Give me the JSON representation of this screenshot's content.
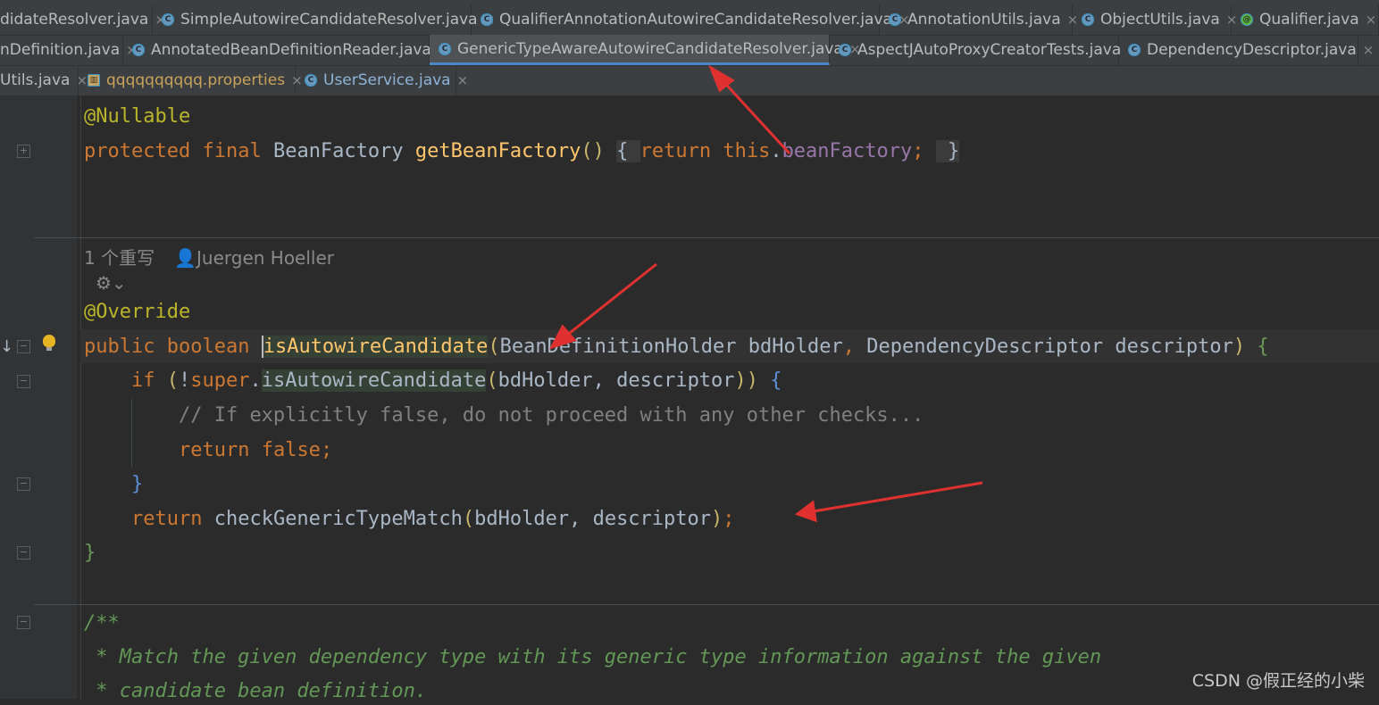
{
  "tabs": {
    "row1": [
      {
        "label": "didateResolver.java",
        "icon": "none"
      },
      {
        "label": "SimpleAutowireCandidateResolver.java",
        "icon": "class-icon"
      },
      {
        "label": "QualifierAnnotationAutowireCandidateResolver.java",
        "icon": "class-icon"
      },
      {
        "label": "AnnotationUtils.java",
        "icon": "abstract-class-icon"
      },
      {
        "label": "ObjectUtils.java",
        "icon": "abstract-class-icon"
      },
      {
        "label": "Qualifier.java",
        "icon": "annotation-icon"
      }
    ],
    "row2": [
      {
        "label": "nDefinition.java",
        "icon": "none"
      },
      {
        "label": "AnnotatedBeanDefinitionReader.java",
        "icon": "class-icon"
      },
      {
        "label": "GenericTypeAwareAutowireCandidateResolver.java",
        "icon": "class-icon",
        "active": true
      },
      {
        "label": "AspectJAutoProxyCreatorTests.java",
        "icon": "test-class-icon"
      },
      {
        "label": "DependencyDescriptor.java",
        "icon": "class-icon"
      }
    ],
    "row3": [
      {
        "label": "Utils.java",
        "icon": "none"
      },
      {
        "label": "qqqqqqqqqq.properties",
        "icon": "properties-icon"
      },
      {
        "label": "UserService.java",
        "icon": "class-icon"
      }
    ],
    "close_glyph": "×"
  },
  "code": {
    "nullable": "@Nullable",
    "getter": {
      "kw_protected": "protected",
      "kw_final": "final",
      "type": "BeanFactory",
      "name": "getBeanFactory",
      "kw_return": "return",
      "kw_this": "this",
      "field": "beanFactory"
    },
    "inlay": {
      "overrides": "1 个重写",
      "author": "Juergen Hoeller"
    },
    "override": "@Override",
    "method": {
      "kw_public": "public",
      "kw_boolean": "boolean",
      "name": "isAutowireCandidate",
      "p1_type": "BeanDefinitionHolder",
      "p1_name": "bdHolder",
      "p2_type": "DependencyDescriptor",
      "p2_name": "descriptor"
    },
    "if_line": {
      "kw_if": "if",
      "kw_super": "super",
      "call": "isAutowireCandidate",
      "args": "bdHolder, descriptor"
    },
    "comment": "// If explicitly false, do not proceed with any other checks...",
    "return_false": {
      "kw_return": "return",
      "kw_false": "false"
    },
    "return_check": {
      "kw_return": "return",
      "call": "checkGenericTypeMatch",
      "args": "bdHolder, descriptor"
    },
    "javadoc": {
      "open": "/**",
      "line1": " * Match the given dependency type with its generic type information against the given",
      "line2": " * candidate bean definition."
    }
  },
  "watermark": "CSDN @假正经的小柴",
  "colors": {
    "editor_bg": "#2b2b2b",
    "keyword": "#cc7832",
    "annotation": "#bbb529",
    "method": "#ffc66d",
    "field": "#9876aa",
    "comment": "#808080",
    "doc": "#629755",
    "arrow": "#e03131",
    "active_tab_underline": "#4a88c7"
  }
}
